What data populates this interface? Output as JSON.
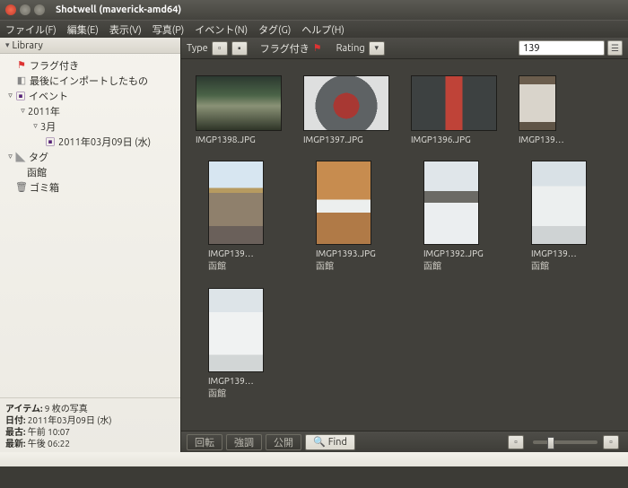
{
  "window": {
    "title": "Shotwell (maverick-amd64)"
  },
  "menu": [
    "ファイル(F)",
    "編集(E)",
    "表示(V)",
    "写真(P)",
    "イベント(N)",
    "タグ(G)",
    "ヘルプ(H)"
  ],
  "sidebar": {
    "header": "Library",
    "items": [
      "フラグ付き",
      "最後にインポートしたもの",
      "イベント",
      "2011年",
      "3月",
      "2011年03月09日 (水)",
      "タグ",
      "函館",
      "ゴミ箱"
    ]
  },
  "status": {
    "k_items": "アイテム:",
    "v_items": "9 枚の写真",
    "k_date": "日付:",
    "v_date": "2011年03月09日 (水)",
    "k_old": "最古:",
    "v_old": "午前 10:07",
    "k_new": "最新:",
    "v_new": "午後 06:22"
  },
  "toolbar": {
    "type": "Type",
    "flag": "フラグ付き",
    "rating": "Rating",
    "search_value": "139"
  },
  "thumbs": [
    {
      "name": "IMGP1398.JPG",
      "tag": ""
    },
    {
      "name": "IMGP1397.JPG",
      "tag": ""
    },
    {
      "name": "IMGP1396.JPG",
      "tag": ""
    },
    {
      "name": "IMGP139…",
      "tag": ""
    },
    {
      "name": "IMGP139…",
      "tag": "函館"
    },
    {
      "name": "IMGP1393.JPG",
      "tag": "函館"
    },
    {
      "name": "IMGP1392.JPG",
      "tag": "函館"
    },
    {
      "name": "IMGP139…",
      "tag": "函館"
    },
    {
      "name": "IMGP139…",
      "tag": "函館"
    }
  ],
  "bottom": {
    "rotate": "回転",
    "enhance": "強調",
    "publish": "公開",
    "find": "Find"
  }
}
